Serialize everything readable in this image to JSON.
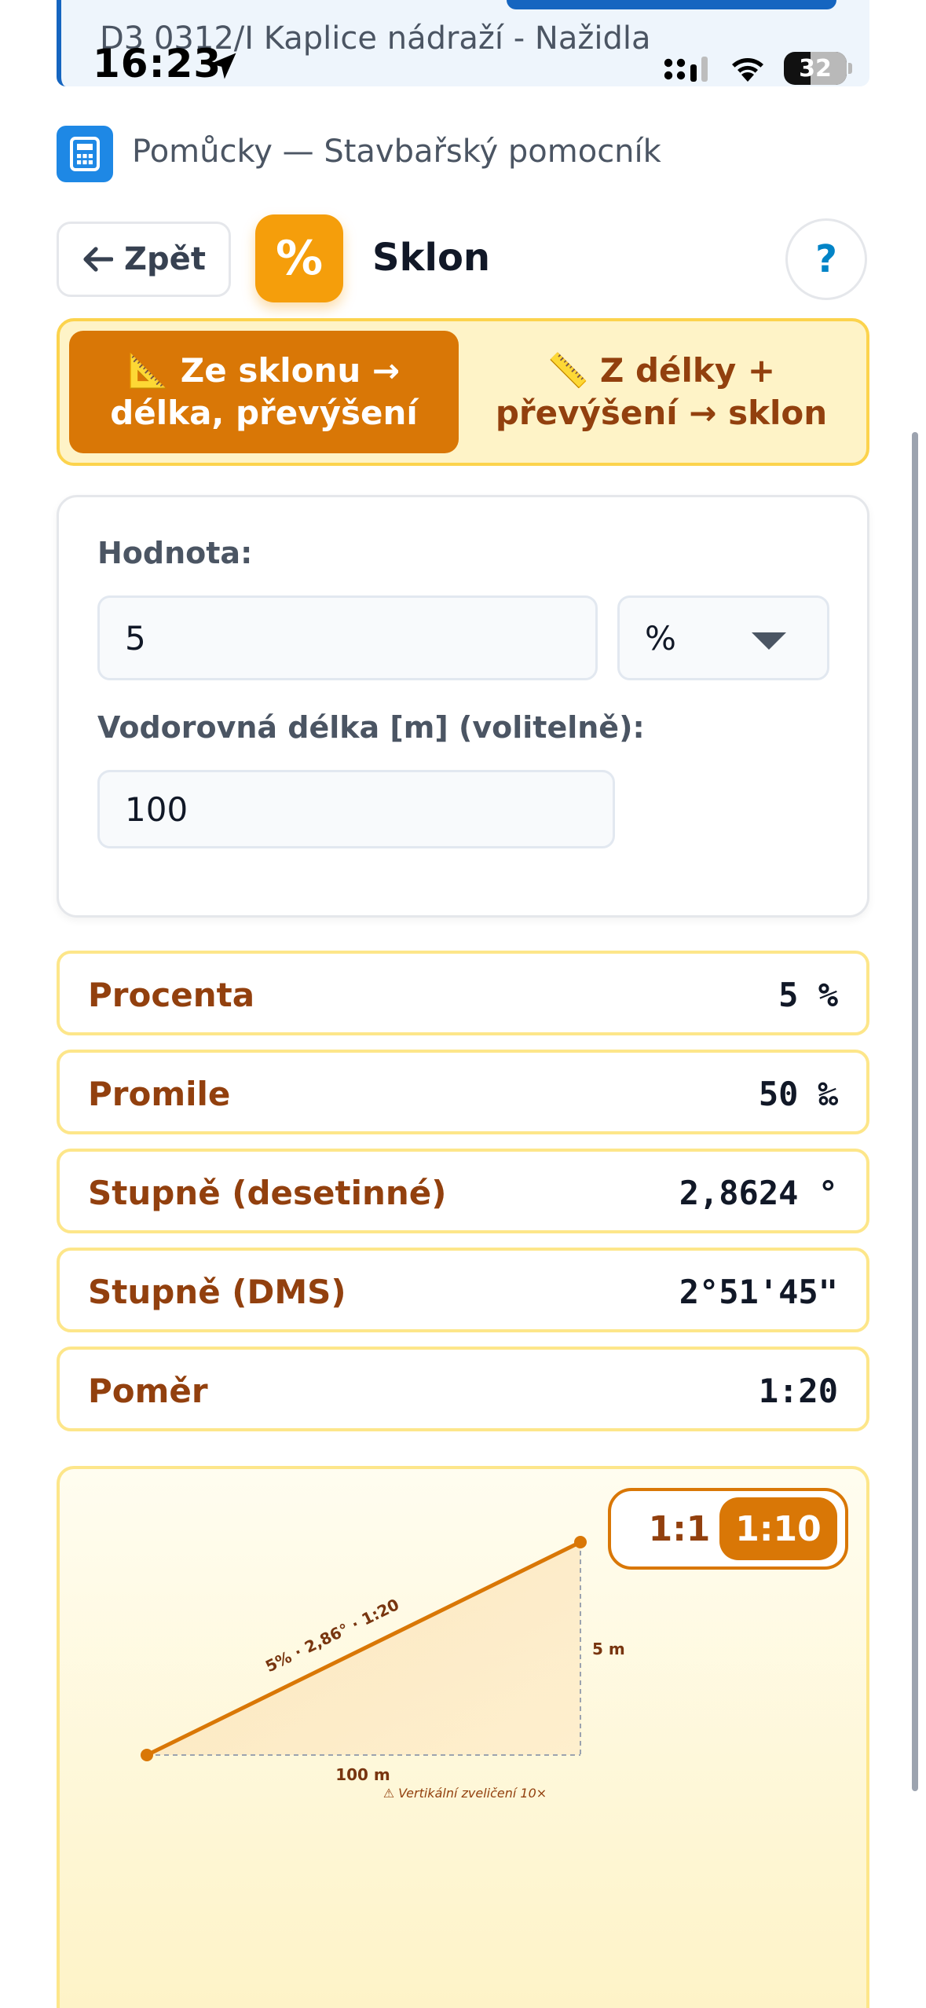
{
  "status_bar": {
    "time": "16:23",
    "battery": "32"
  },
  "banner": {
    "text": "D3 0312/I Kaplice nádraží - Nažidla"
  },
  "breadcrumb": {
    "text": "Pomůcky — Stavbařský pomocník"
  },
  "header": {
    "back_label": "Zpět",
    "tile_symbol": "%",
    "title": "Sklon",
    "help_label": "?"
  },
  "modes": {
    "active_line1": "📐 Ze sklonu →",
    "active_line2": "délka, převýšení",
    "inactive_line1": "📏 Z délky +",
    "inactive_line2": "převýšení → sklon"
  },
  "form": {
    "value_label": "Hodnota:",
    "value": "5",
    "unit": "%",
    "length_label": "Vodorovná délka [m] (volitelně):",
    "length": "100"
  },
  "results": [
    {
      "label": "Procenta",
      "value": "5 %"
    },
    {
      "label": "Promile",
      "value": "50 ‰"
    },
    {
      "label": "Stupně (desetinné)",
      "value": "2,8624 °"
    },
    {
      "label": "Stupně (DMS)",
      "value": "2°51'45\""
    },
    {
      "label": "Poměr",
      "value": "1:20"
    }
  ],
  "diagram": {
    "scale_options": [
      "1:1",
      "1:10"
    ],
    "selected_scale": "1:10",
    "slope_label": "5% · 2,86° · 1:20",
    "height_label": "5 m",
    "length_label": "100 m",
    "exaggeration_note": "⚠ Vertikální zveličení 10×",
    "accent_color": "#d97706"
  }
}
